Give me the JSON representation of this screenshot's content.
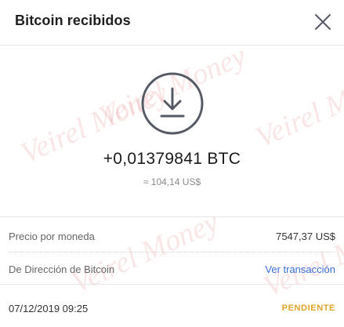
{
  "header": {
    "title": "Bitcoin recibidos"
  },
  "icons": {
    "close": "close-icon",
    "receive": "download-arrow-icon"
  },
  "watermark": {
    "text": "Veirel Money"
  },
  "amount": {
    "crypto": "+0,01379841 BTC",
    "fiat": "≈ 104,14 US$"
  },
  "details": [
    {
      "label": "Precio por moneda",
      "value": "7547,37 US$"
    },
    {
      "label": "De Dirección de Bitcoin",
      "value": "Ver transacción"
    }
  ],
  "footer": {
    "date": "07/12/2019 09:25",
    "status": "PENDIENTE"
  },
  "colors": {
    "link": "#3b6fd8",
    "status_pending": "#e0a429",
    "icon": "#555a64"
  }
}
